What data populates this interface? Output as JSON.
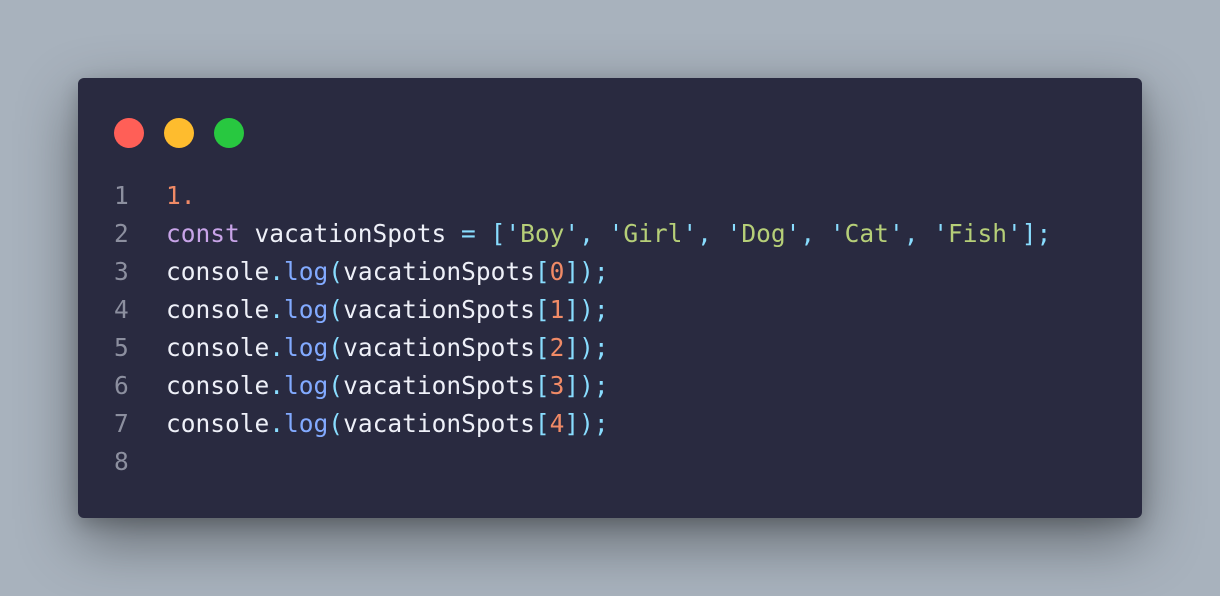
{
  "window": {
    "controls": [
      {
        "name": "close-light",
        "color": "#ff5f57"
      },
      {
        "name": "minimize-light",
        "color": "#febc2e"
      },
      {
        "name": "maximize-light",
        "color": "#28c840"
      }
    ]
  },
  "code": {
    "lines": [
      {
        "number": "1",
        "tokens": [
          {
            "type": "num",
            "text": "1."
          }
        ]
      },
      {
        "number": "2",
        "tokens": [
          {
            "type": "kw",
            "text": "const"
          },
          {
            "type": "id",
            "text": " vacationSpots "
          },
          {
            "type": "punc",
            "text": "="
          },
          {
            "type": "id",
            "text": " "
          },
          {
            "type": "punc",
            "text": "['"
          },
          {
            "type": "str",
            "text": "Boy"
          },
          {
            "type": "punc",
            "text": "', '"
          },
          {
            "type": "str",
            "text": "Girl"
          },
          {
            "type": "punc",
            "text": "', '"
          },
          {
            "type": "str",
            "text": "Dog"
          },
          {
            "type": "punc",
            "text": "', '"
          },
          {
            "type": "str",
            "text": "Cat"
          },
          {
            "type": "punc",
            "text": "', '"
          },
          {
            "type": "str",
            "text": "Fish"
          },
          {
            "type": "punc",
            "text": "'];"
          }
        ]
      },
      {
        "number": "3",
        "tokens": [
          {
            "type": "id",
            "text": "console"
          },
          {
            "type": "punc",
            "text": "."
          },
          {
            "type": "fn",
            "text": "log"
          },
          {
            "type": "punc",
            "text": "("
          },
          {
            "type": "id",
            "text": "vacationSpots"
          },
          {
            "type": "punc",
            "text": "["
          },
          {
            "type": "num",
            "text": "0"
          },
          {
            "type": "punc",
            "text": "]);"
          }
        ]
      },
      {
        "number": "4",
        "tokens": [
          {
            "type": "id",
            "text": "console"
          },
          {
            "type": "punc",
            "text": "."
          },
          {
            "type": "fn",
            "text": "log"
          },
          {
            "type": "punc",
            "text": "("
          },
          {
            "type": "id",
            "text": "vacationSpots"
          },
          {
            "type": "punc",
            "text": "["
          },
          {
            "type": "num",
            "text": "1"
          },
          {
            "type": "punc",
            "text": "]);"
          }
        ]
      },
      {
        "number": "5",
        "tokens": [
          {
            "type": "id",
            "text": "console"
          },
          {
            "type": "punc",
            "text": "."
          },
          {
            "type": "fn",
            "text": "log"
          },
          {
            "type": "punc",
            "text": "("
          },
          {
            "type": "id",
            "text": "vacationSpots"
          },
          {
            "type": "punc",
            "text": "["
          },
          {
            "type": "num",
            "text": "2"
          },
          {
            "type": "punc",
            "text": "]);"
          }
        ]
      },
      {
        "number": "6",
        "tokens": [
          {
            "type": "id",
            "text": "console"
          },
          {
            "type": "punc",
            "text": "."
          },
          {
            "type": "fn",
            "text": "log"
          },
          {
            "type": "punc",
            "text": "("
          },
          {
            "type": "id",
            "text": "vacationSpots"
          },
          {
            "type": "punc",
            "text": "["
          },
          {
            "type": "num",
            "text": "3"
          },
          {
            "type": "punc",
            "text": "]);"
          }
        ]
      },
      {
        "number": "7",
        "tokens": [
          {
            "type": "id",
            "text": "console"
          },
          {
            "type": "punc",
            "text": "."
          },
          {
            "type": "fn",
            "text": "log"
          },
          {
            "type": "punc",
            "text": "("
          },
          {
            "type": "id",
            "text": "vacationSpots"
          },
          {
            "type": "punc",
            "text": "["
          },
          {
            "type": "num",
            "text": "4"
          },
          {
            "type": "punc",
            "text": "]);"
          }
        ]
      },
      {
        "number": "8",
        "tokens": []
      }
    ]
  }
}
